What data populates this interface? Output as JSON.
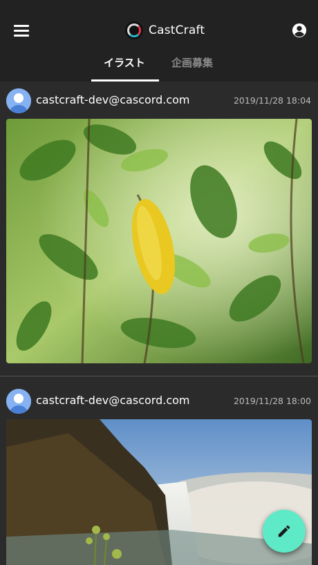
{
  "app": {
    "title": "CastCraft"
  },
  "tabs": [
    {
      "label": "イラスト",
      "active": true
    },
    {
      "label": "企画募集",
      "active": false
    }
  ],
  "posts": [
    {
      "author": "castcraft-dev@cascord.com",
      "timestamp": "2019/11/28 18:04",
      "image": "yellow-leaf-plant-photo"
    },
    {
      "author": "castcraft-dev@cascord.com",
      "timestamp": "2019/11/28 18:00",
      "image": "waterfall-cliff-photo"
    }
  ],
  "icons": {
    "menu": "menu-icon",
    "logo": "castcraft-logo",
    "account": "account-circle-icon",
    "avatar": "user-avatar-icon",
    "fab": "pencil-edit-icon"
  },
  "colors": {
    "appbar": "#222222",
    "background": "#2b2b2b",
    "fab": "#5eeac6",
    "avatar": "#86b2f2"
  }
}
